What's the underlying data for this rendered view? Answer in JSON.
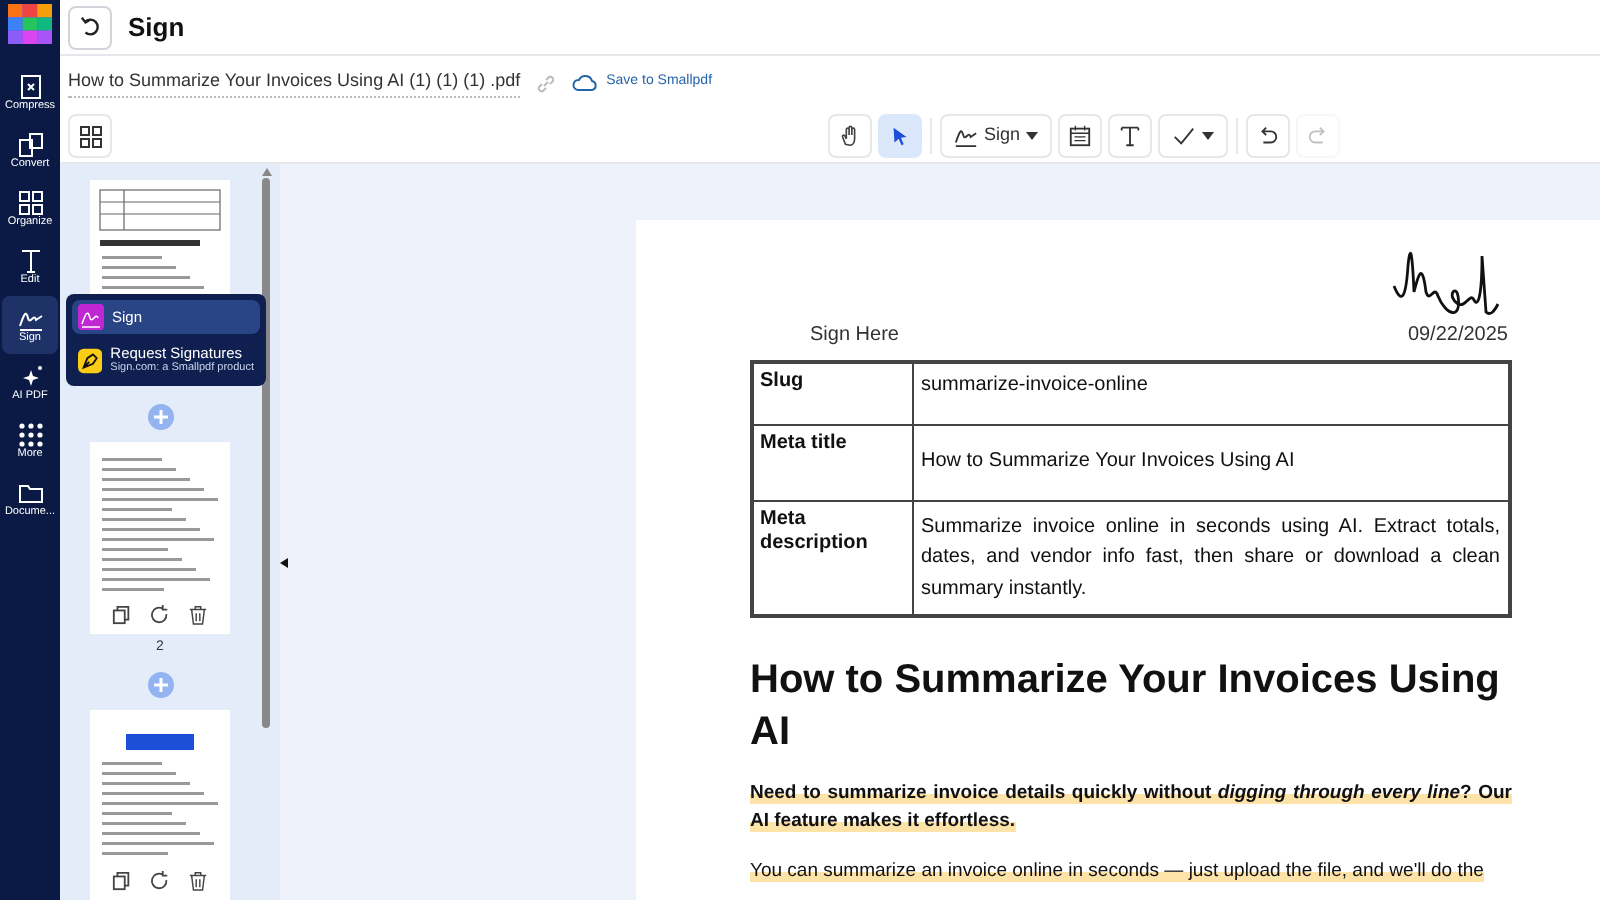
{
  "sidebar": {
    "items": [
      {
        "label": "Compress",
        "selected": false
      },
      {
        "label": "Convert",
        "selected": false
      },
      {
        "label": "Organize",
        "selected": false
      },
      {
        "label": "Edit",
        "selected": false
      },
      {
        "label": "Sign",
        "selected": true
      },
      {
        "label": "AI PDF",
        "selected": false
      },
      {
        "label": "More",
        "selected": false
      },
      {
        "label": "Docume...",
        "selected": false
      }
    ]
  },
  "header": {
    "title": "Sign"
  },
  "file": {
    "name": "How to Summarize Your Invoices Using AI (1) (1) (1) .pdf",
    "save_label": "Save to Smallpdf"
  },
  "toolbar": {
    "tools": [
      {
        "kind": "hand",
        "selected": false,
        "disabled": false
      },
      {
        "kind": "pointer",
        "selected": true,
        "disabled": false
      },
      {
        "kind": "sign",
        "label": "Sign",
        "selected": false,
        "disabled": false
      },
      {
        "kind": "calendar",
        "selected": false,
        "disabled": false
      },
      {
        "kind": "text",
        "selected": false,
        "disabled": false
      },
      {
        "kind": "check",
        "selected": false,
        "disabled": false
      },
      {
        "kind": "undo",
        "selected": false,
        "disabled": false
      },
      {
        "kind": "redo",
        "selected": false,
        "disabled": true
      }
    ]
  },
  "thumbnails": {
    "pages": [
      {
        "kind": "table"
      },
      {
        "kind": "text",
        "number": "2",
        "actions": true
      },
      {
        "kind": "banner",
        "actions": true
      }
    ]
  },
  "sign_menu": {
    "items": [
      {
        "kind": "sign",
        "label": "Sign",
        "selected": true
      },
      {
        "kind": "request",
        "label": "Request Signatures",
        "sublabel": "Sign.com: a Smallpdf product",
        "selected": false
      }
    ]
  },
  "document": {
    "sign_label": "Sign Here",
    "date": "09/22/2025",
    "table": {
      "rows": [
        {
          "label": "Slug",
          "value": "summarize-invoice-online"
        },
        {
          "label": "Meta title",
          "value": "How to Summarize Your Invoices Using AI"
        },
        {
          "label": "Meta description",
          "value": "Summarize invoice online in seconds using AI. Extract totals, dates, and vendor info fast, then share or download a clean summary instantly."
        }
      ]
    },
    "heading": "How to Summarize Your Invoices Using AI",
    "paragraphs": [
      {
        "text": "Need to summarize invoice details quickly without *digging through every line*? Our AI feature makes it effortless.",
        "bold": true,
        "highlighted": true
      },
      {
        "text": "You can summarize an invoice online in seconds — just upload the file, and we'll do the",
        "bold": false,
        "highlighted": true
      }
    ]
  }
}
